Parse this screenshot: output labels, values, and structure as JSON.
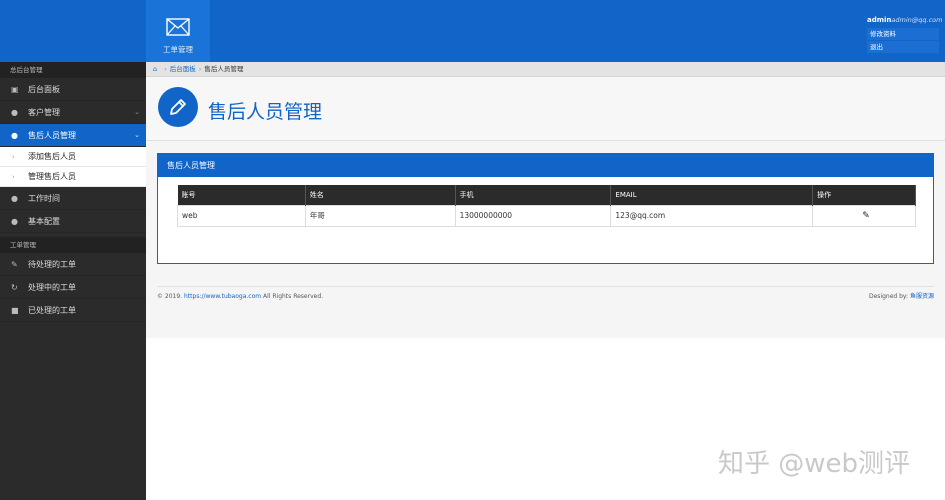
{
  "header": {
    "tile_label": "工单管理",
    "user_name": "admin",
    "user_email": "admin@qq.com",
    "menu": [
      "修改资料",
      "退出"
    ]
  },
  "sidebar": {
    "sections": [
      {
        "title": "总后台管理",
        "items": [
          {
            "label": "后台面板",
            "icon": "monitor-icon"
          },
          {
            "label": "客户管理",
            "icon": "user-icon",
            "has_chevron": true
          },
          {
            "label": "售后人员管理",
            "icon": "comments-icon",
            "active": true,
            "has_chevron": true,
            "children": [
              {
                "label": "添加售后人员"
              },
              {
                "label": "管理售后人员"
              }
            ]
          },
          {
            "label": "工作时间",
            "icon": "comments-icon"
          },
          {
            "label": "基本配置",
            "icon": "comments-icon"
          }
        ]
      },
      {
        "title": "工单管理",
        "items": [
          {
            "label": "待处理的工单",
            "icon": "pencil-icon"
          },
          {
            "label": "处理中的工单",
            "icon": "refresh-icon"
          },
          {
            "label": "已处理的工单",
            "icon": "briefcase-icon"
          }
        ]
      }
    ]
  },
  "breadcrumb": [
    "后台面板",
    "售后人员管理"
  ],
  "page": {
    "title": "售后人员管理",
    "panel_title": "售后人员管理"
  },
  "table": {
    "columns": [
      "账号",
      "姓名",
      "手机",
      "EMAIL",
      "操作"
    ],
    "rows": [
      {
        "account": "web",
        "name": "年哥",
        "phone": "13000000000",
        "email": "123@qq.com"
      }
    ]
  },
  "footer": {
    "copyright_prefix": "© 2019. ",
    "site_link": "https://www.tubaoga.com",
    "copyright_suffix": " All Rights Reserved.",
    "designed_by": "Designed by: ",
    "designer": "鱼服资源"
  },
  "watermark": "知乎 @web测评",
  "colors": {
    "brand": "#1164c8",
    "sidebar": "#2b2b2b",
    "table_header": "#2b2b2b"
  }
}
